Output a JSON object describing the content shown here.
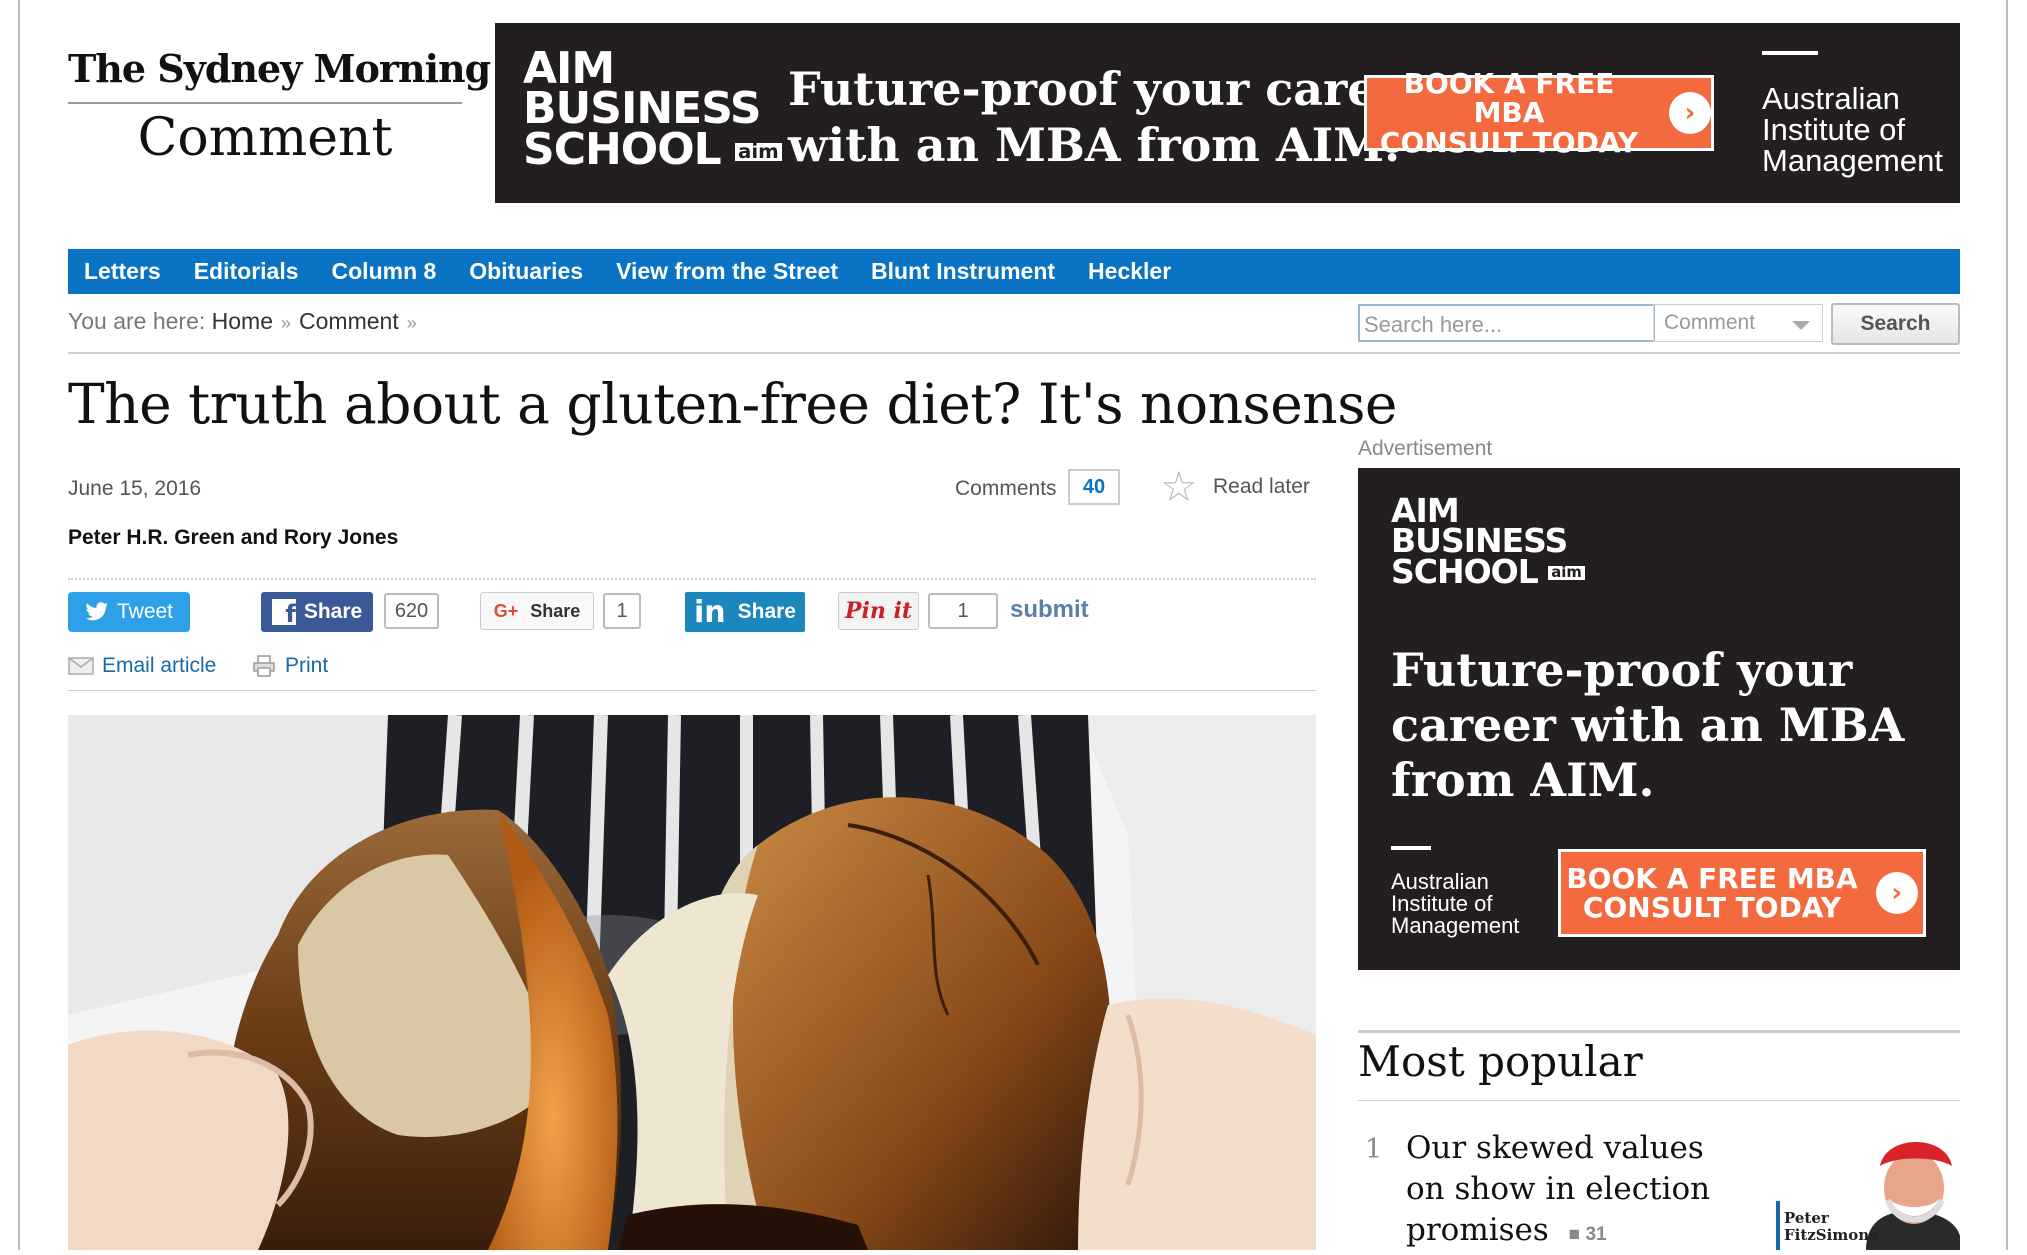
{
  "masthead": {
    "publication": "The Sydney Morning Herald",
    "section": "Comment"
  },
  "top_ad": {
    "logo_line1": "AIM",
    "logo_line2": "BUSINESS",
    "logo_line3": "SCHOOL",
    "logo_badge": "aim",
    "headline_line1": "Future-proof your career",
    "headline_line2": "with an MBA from AIM.",
    "cta_line1": "BOOK A FREE MBA",
    "cta_line2": "CONSULT TODAY",
    "institute_line1": "Australian",
    "institute_line2": "Institute of",
    "institute_line3": "Management"
  },
  "nav": {
    "items": [
      "Letters",
      "Editorials",
      "Column 8",
      "Obituaries",
      "View from the Street",
      "Blunt Instrument",
      "Heckler"
    ]
  },
  "breadcrumb": {
    "prefix": "You are here:",
    "home": "Home",
    "current": "Comment"
  },
  "search": {
    "placeholder": "Search here...",
    "scope": "Comment",
    "button": "Search"
  },
  "article": {
    "headline": "The truth about a gluten-free diet? It's nonsense",
    "date": "June 15, 2016",
    "authors": "Peter H.R. Green and Rory Jones",
    "comments_label": "Comments",
    "comments_count": "40",
    "read_later": "Read later"
  },
  "share": {
    "tweet": "Tweet",
    "facebook": "Share",
    "facebook_count": "620",
    "gplus": "Share",
    "gplus_count": "1",
    "linkedin": "Share",
    "pinterest": "Pin it",
    "pinterest_count": "1",
    "submit": "submit",
    "email": "Email article",
    "print": "Print"
  },
  "sidebar": {
    "advertisement_label": "Advertisement",
    "ad": {
      "logo_line1": "AIM",
      "logo_line2": "BUSINESS",
      "logo_line3": "SCHOOL",
      "logo_badge": "aim",
      "headline_line1": "Future-proof your",
      "headline_line2": "career with an MBA",
      "headline_line3": "from AIM.",
      "institute_line1": "Australian",
      "institute_line2": "Institute of",
      "institute_line3": "Management",
      "cta_line1": "BOOK A FREE MBA",
      "cta_line2": "CONSULT TODAY"
    },
    "most_popular": {
      "title": "Most popular",
      "items": [
        {
          "rank": "1",
          "title": "Our skewed values on show in election promises",
          "comments": "31",
          "thumb_caption_line1": "Peter",
          "thumb_caption_line2": "FitzSimons"
        }
      ]
    }
  },
  "colors": {
    "nav_blue": "#0a73c4",
    "ad_dark": "#231f20",
    "ad_orange": "#f26a3e",
    "twitter": "#2ea0e8",
    "facebook": "#3b5998",
    "linkedin": "#1c87bd",
    "pinterest": "#cb2027"
  },
  "icons": [
    "twitter-icon",
    "facebook-icon",
    "gplus-icon",
    "linkedin-icon",
    "star-icon",
    "email-icon",
    "print-icon",
    "chevron-right-icon",
    "comment-bubble-icon",
    "dropdown-caret-icon"
  ]
}
